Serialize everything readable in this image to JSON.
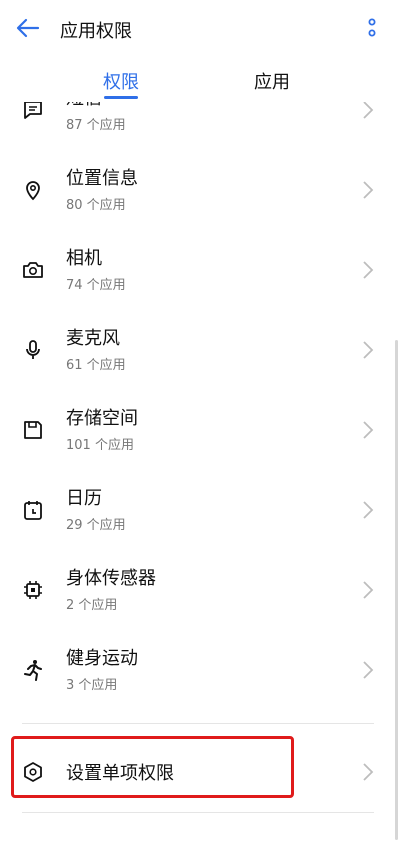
{
  "header": {
    "title": "应用权限",
    "back_icon": "arrow-left-icon",
    "more_icon": "more-vertical-icon"
  },
  "tabs": [
    {
      "label": "权限",
      "active": true
    },
    {
      "label": "应用",
      "active": false
    }
  ],
  "permissions": [
    {
      "name": "短信",
      "count": "87 个应用",
      "icon": "message-icon"
    },
    {
      "name": "位置信息",
      "count": "80 个应用",
      "icon": "location-icon"
    },
    {
      "name": "相机",
      "count": "74 个应用",
      "icon": "camera-icon"
    },
    {
      "name": "麦克风",
      "count": "61 个应用",
      "icon": "microphone-icon"
    },
    {
      "name": "存储空间",
      "count": "101 个应用",
      "icon": "storage-icon"
    },
    {
      "name": "日历",
      "count": "29 个应用",
      "icon": "calendar-icon"
    },
    {
      "name": "身体传感器",
      "count": "2 个应用",
      "icon": "chip-icon"
    },
    {
      "name": "健身运动",
      "count": "3 个应用",
      "icon": "running-icon"
    }
  ],
  "single_permission": {
    "label": "设置单项权限",
    "icon": "hexagon-settings-icon"
  },
  "colors": {
    "accent": "#2f6fe8",
    "highlight": "#e01b1b",
    "secondary_text": "#777777"
  }
}
